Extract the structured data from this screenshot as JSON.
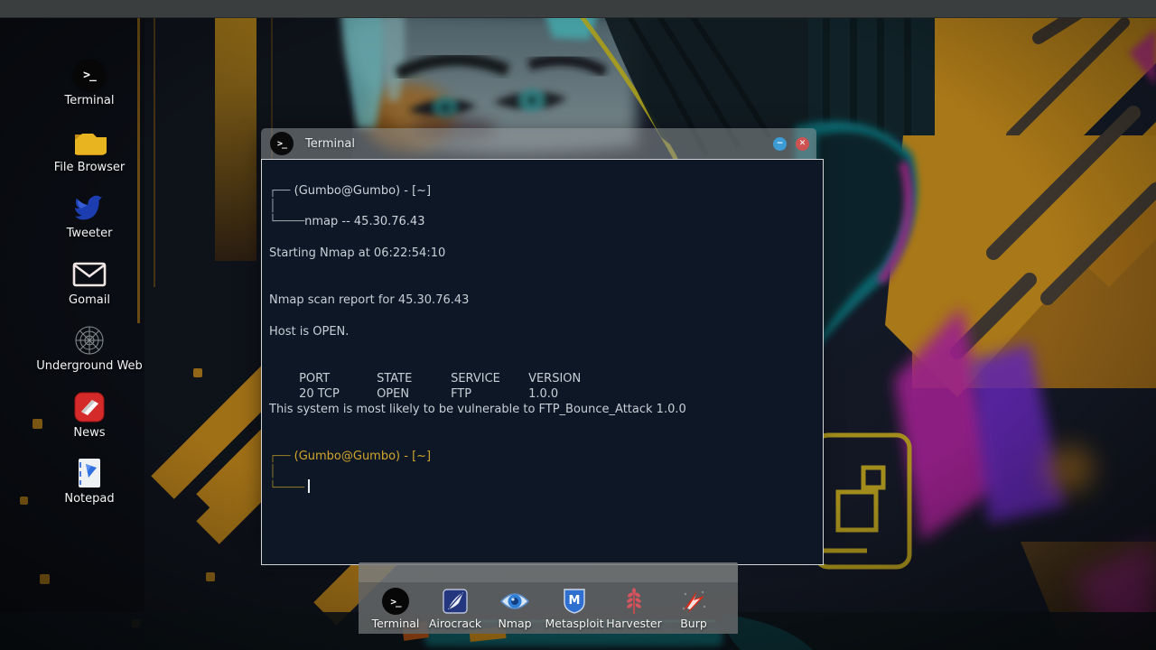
{
  "glyphs": {
    "terminal": ">_"
  },
  "desktop": {
    "icons": [
      {
        "label": "Terminal"
      },
      {
        "label": "File Browser"
      },
      {
        "label": "Tweeter"
      },
      {
        "label": "Gomail"
      },
      {
        "label": "Underground Web"
      },
      {
        "label": "News"
      },
      {
        "label": "Notepad"
      }
    ]
  },
  "window": {
    "title": "Terminal",
    "controls": {
      "minimize_glyph": "−",
      "close_glyph": "✕"
    },
    "terminal": {
      "prompt1": {
        "top": "┌──",
        "user": " (Gumbo@Gumbo) - [~]",
        "mid": "│",
        "bottom": "└────",
        "command": "nmap -- 45.30.76.43"
      },
      "starting_line": "Starting Nmap at 06:22:54:10",
      "report_line": "Nmap scan report for 45.30.76.43",
      "host_line": "Host is OPEN.",
      "table": {
        "headers": [
          "PORT",
          "STATE",
          "SERVICE",
          "VERSION"
        ],
        "row": [
          "20 TCP",
          "OPEN",
          "FTP",
          "1.0.0"
        ]
      },
      "vuln_line": "This system is most likely to be vulnerable to FTP_Bounce_Attack 1.0.0",
      "prompt2": {
        "top": "┌──",
        "user": " (Gumbo@Gumbo) - [~]",
        "mid": "│",
        "bottom": "└────"
      }
    }
  },
  "dock": {
    "items": [
      {
        "label": "Terminal"
      },
      {
        "label": "Airocrack"
      },
      {
        "label": "Nmap"
      },
      {
        "label": "Metasploit"
      },
      {
        "label": "Harvester"
      },
      {
        "label": "Burp"
      }
    ]
  },
  "colors": {
    "prompt_gold": "#d2a62c",
    "prompt_gold_dim": "#8a7428",
    "terminal_text": "#c7cfd6",
    "terminal_bg": "#0d1726",
    "minimize_blue": "#3d9bd6",
    "close_red": "#cd5252"
  }
}
